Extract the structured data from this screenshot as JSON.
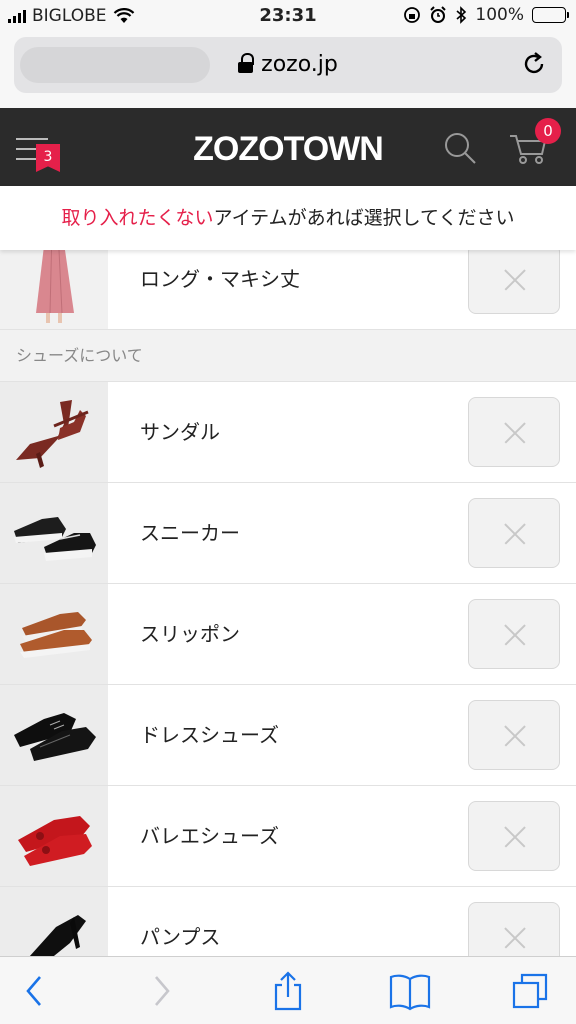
{
  "status": {
    "carrier": "BIGLOBE",
    "time": "23:31",
    "battery": "100%"
  },
  "browser": {
    "url": "zozo.jp"
  },
  "header": {
    "logo": "ZOZOTOWN",
    "menu_badge": "3",
    "cart_count": "0"
  },
  "instruction": {
    "highlight": "取り入れたくない",
    "rest": "アイテムがあれば選択してください"
  },
  "top_item": {
    "label": "ロング・マキシ丈"
  },
  "section": {
    "title": "シューズについて"
  },
  "items": [
    {
      "label": "サンダル"
    },
    {
      "label": "スニーカー"
    },
    {
      "label": "スリッポン"
    },
    {
      "label": "ドレスシューズ"
    },
    {
      "label": "バレエシューズ"
    },
    {
      "label": "パンプス"
    }
  ],
  "colors": {
    "accent": "#e5204a",
    "header_bg": "#2b2b2b",
    "ios_blue": "#1a73e8"
  },
  "icons": [
    "lock-icon",
    "reload-icon",
    "menu-icon",
    "search-icon",
    "cart-icon",
    "close-icon",
    "back-icon",
    "forward-icon",
    "share-icon",
    "bookmarks-icon",
    "tabs-icon"
  ]
}
